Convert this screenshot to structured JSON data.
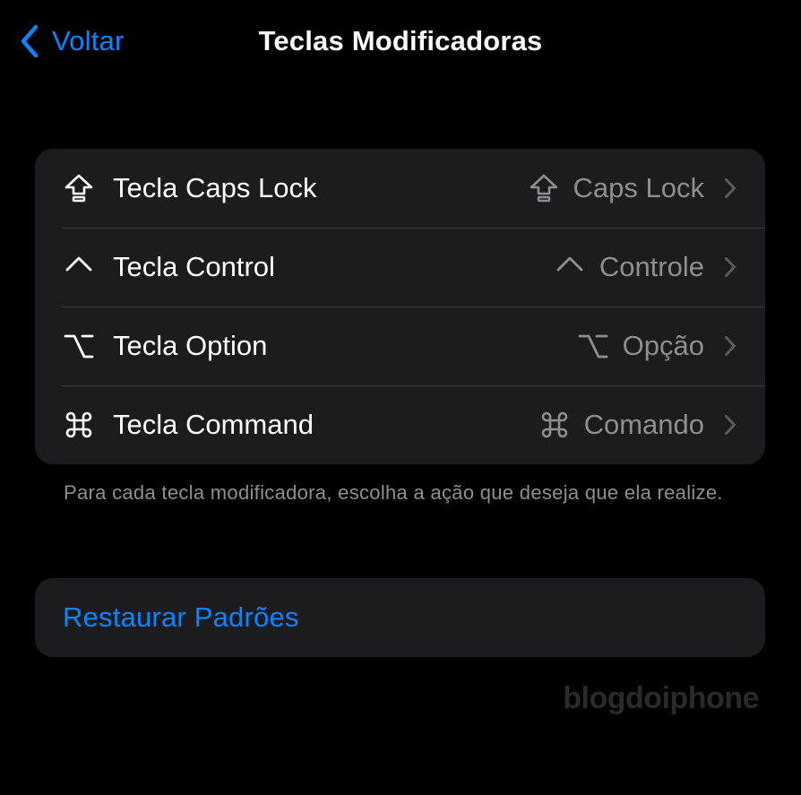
{
  "nav": {
    "back_label": "Voltar",
    "title": "Teclas Modificadoras",
    "back_icon": "chevron-left-icon"
  },
  "keys": [
    {
      "label": "Tecla Caps Lock",
      "value": "Caps Lock",
      "icon": "caps-lock-icon"
    },
    {
      "label": "Tecla Control",
      "value": "Controle",
      "icon": "control-icon"
    },
    {
      "label": "Tecla Option",
      "value": "Opção",
      "icon": "option-icon"
    },
    {
      "label": "Tecla Command",
      "value": "Comando",
      "icon": "command-icon"
    }
  ],
  "footer": "Para cada tecla modificadora, escolha a ação que deseja que ela realize.",
  "restore": {
    "label": "Restaurar Padrões"
  },
  "watermark": "blogdoiphone",
  "colors": {
    "accent": "#0a84ff",
    "background": "#000000",
    "cell": "#1c1c1e",
    "secondary_text": "#8e8e93",
    "separator": "#38383a"
  }
}
